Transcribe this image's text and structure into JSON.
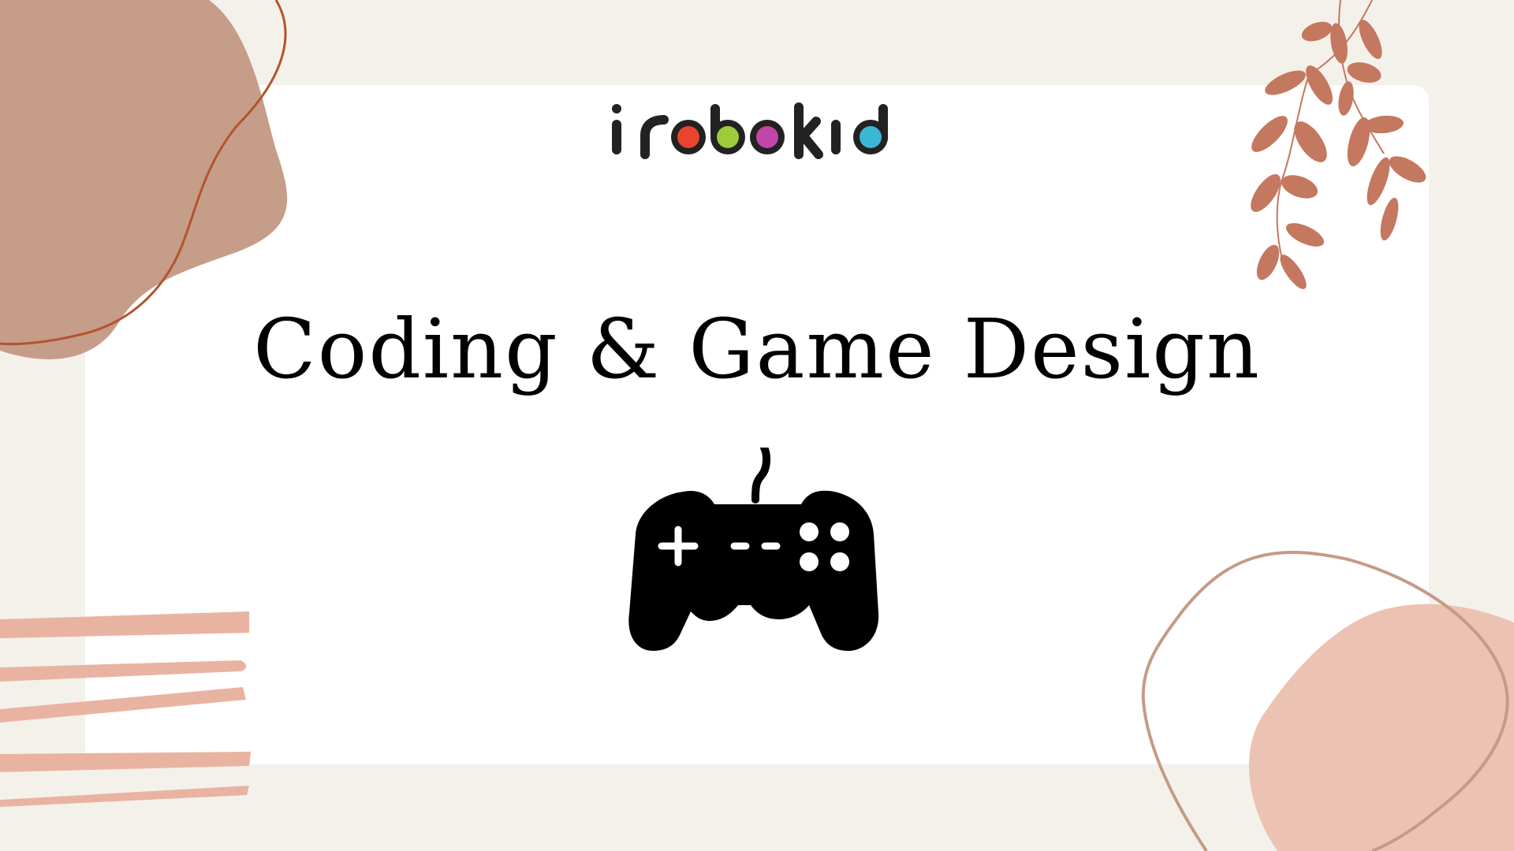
{
  "logo": {
    "text": "irobokid",
    "dot_colors": [
      "#e8452e",
      "#9ccb3b",
      "#c146a8",
      "#3ab7d4"
    ]
  },
  "title": "Coding & Game Design",
  "icons": {
    "main": "game-controller-icon"
  },
  "colors": {
    "background": "#f4f1eb",
    "card": "#ffffff",
    "blob_dark": "#c69d89",
    "blob_light": "#ecc2b3",
    "stripes": "#e9b3a2",
    "outline": "#b4532e",
    "leaves": "#c4785f"
  }
}
